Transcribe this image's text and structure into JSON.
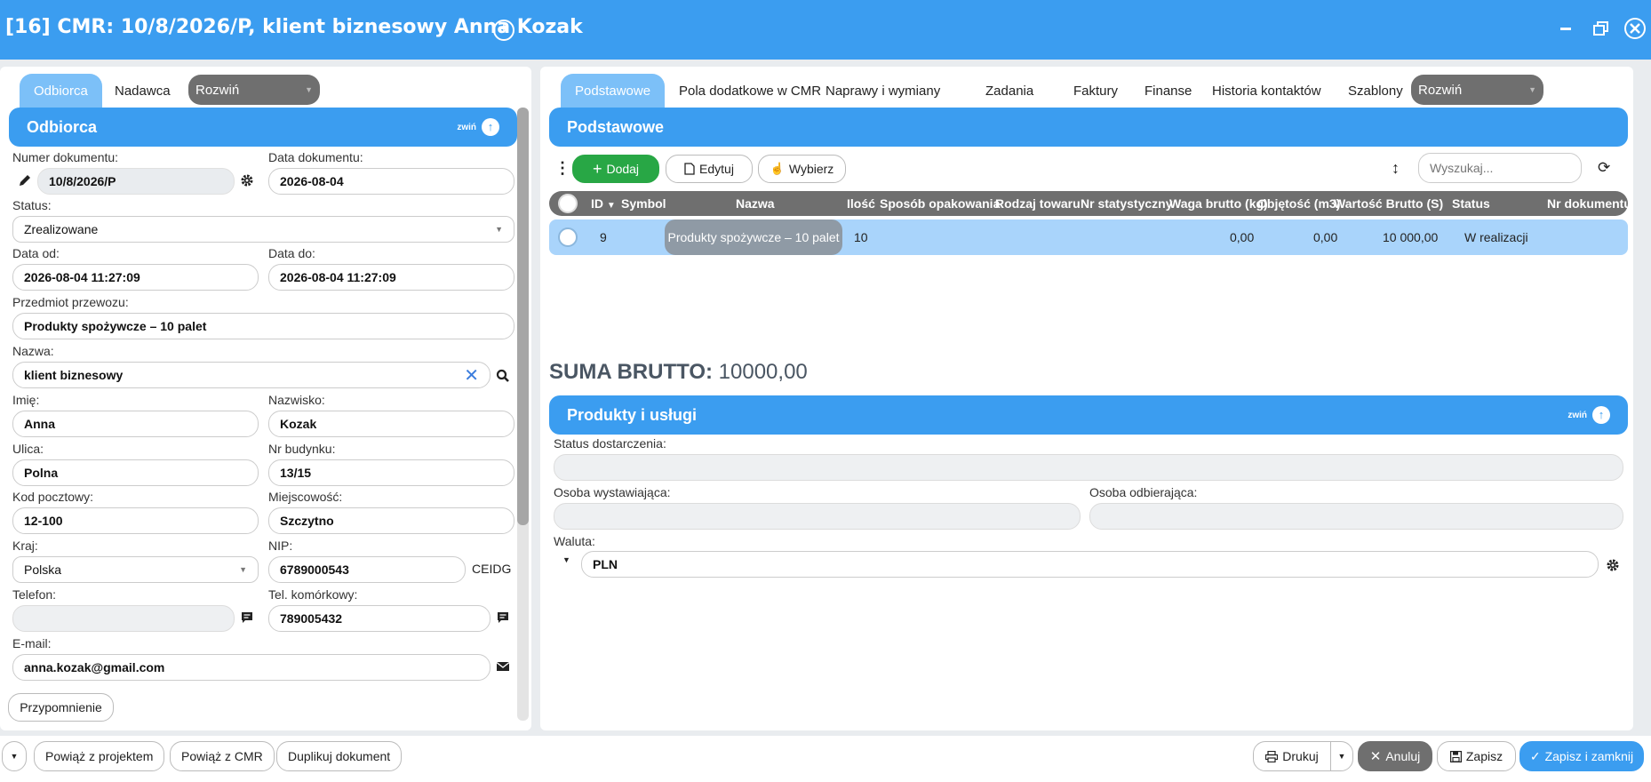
{
  "window": {
    "title": "[16] CMR: 10/8/2026/P, klient biznesowy Anna Kozak",
    "add_icon": "plus-circle-icon",
    "minimize_icon": "minimize-icon",
    "restore_icon": "restore-icon",
    "close_icon": "close-circle-icon"
  },
  "left": {
    "tabs": [
      "Odbiorca",
      "Nadawca"
    ],
    "expand_label": "Rozwiń",
    "section_title": "Odbiorca",
    "collapse_label": "zwiń",
    "fields": {
      "numer_dokumentu": {
        "label": "Numer dokumentu:",
        "value": "10/8/2026/P"
      },
      "data_dokumentu": {
        "label": "Data dokumentu:",
        "value": "2026-08-04"
      },
      "status": {
        "label": "Status:",
        "value": "Zrealizowane"
      },
      "data_od": {
        "label": "Data od:",
        "value": "2026-08-04 11:27:09"
      },
      "data_do": {
        "label": "Data do:",
        "value": "2026-08-04 11:27:09"
      },
      "przedmiot": {
        "label": "Przedmiot przewozu:",
        "value": "Produkty spożywcze – 10 palet"
      },
      "nazwa": {
        "label": "Nazwa:",
        "value": "klient biznesowy"
      },
      "imie": {
        "label": "Imię:",
        "value": "Anna"
      },
      "nazwisko": {
        "label": "Nazwisko:",
        "value": "Kozak"
      },
      "ulica": {
        "label": "Ulica:",
        "value": "Polna"
      },
      "nr_budynku": {
        "label": "Nr budynku:",
        "value": "13/15"
      },
      "kod_pocztowy": {
        "label": "Kod pocztowy:",
        "value": "12-100"
      },
      "miejscowosc": {
        "label": "Miejscowość:",
        "value": "Szczytno"
      },
      "kraj": {
        "label": "Kraj:",
        "value": "Polska"
      },
      "nip": {
        "label": "NIP:",
        "value": "6789000543"
      },
      "ceidg_label": "CEIDG",
      "telefon": {
        "label": "Telefon:",
        "value": ""
      },
      "tel_komorkowy": {
        "label": "Tel. komórkowy:",
        "value": "789005432"
      },
      "email": {
        "label": "E-mail:",
        "value": "anna.kozak@gmail.com"
      }
    },
    "reminder_button": "Przypomnienie"
  },
  "right": {
    "tabs": [
      "Podstawowe",
      "Pola dodatkowe w CMR",
      "Naprawy i wymiany",
      "Zadania",
      "Faktury",
      "Finanse",
      "Historia kontaktów",
      "Szablony"
    ],
    "expand_label": "Rozwiń",
    "section_title": "Podstawowe",
    "toolbar": {
      "add": "Dodaj",
      "edit": "Edytuj",
      "choose": "Wybierz",
      "search_placeholder": "Wyszukaj..."
    },
    "table": {
      "columns": [
        "ID",
        "Symbol",
        "Nazwa",
        "Ilość",
        "Sposób opakowania",
        "Rodzaj towaru",
        "Nr statystyczny",
        "Waga brutto (kg)",
        "Objętość (m3)",
        "Wartość Brutto (S)",
        "Status",
        "Nr dokumentu"
      ],
      "rows": [
        {
          "id": "9",
          "symbol": "",
          "nazwa": "Produkty spożywcze – 10 palet",
          "ilosc": "10",
          "sposob": "",
          "rodzaj": "",
          "nr_stat": "",
          "waga": "0,00",
          "objetosc": "0,00",
          "wartosc": "10 000,00",
          "status": "W realizacji",
          "nr_dok": ""
        }
      ]
    },
    "sum_label": "SUMA BRUTTO:",
    "sum_value": "10000,00",
    "products_section": {
      "title": "Produkty i usługi",
      "collapse_label": "zwiń",
      "status_dostarczenia": {
        "label": "Status dostarczenia:",
        "value": ""
      },
      "osoba_wystawiajaca": {
        "label": "Osoba wystawiająca:",
        "value": ""
      },
      "osoba_odbierajaca": {
        "label": "Osoba odbierająca:",
        "value": ""
      },
      "waluta": {
        "label": "Waluta:",
        "value": "PLN"
      }
    }
  },
  "footer": {
    "buttons_left": [
      "Powiąż z projektem",
      "Powiąż z CMR",
      "Duplikuj dokument"
    ],
    "print": "Drukuj",
    "cancel": "Anuluj",
    "save": "Zapisz",
    "save_close": "Zapisz i zamknij"
  },
  "colors": {
    "accent": "#3b9df0",
    "tab_active": "#7cc0f8",
    "add_button": "#28a745",
    "table_header": "#6f6f6f",
    "row_highlight": "#a9d4fb",
    "cancel_button": "#6f6f6f"
  }
}
